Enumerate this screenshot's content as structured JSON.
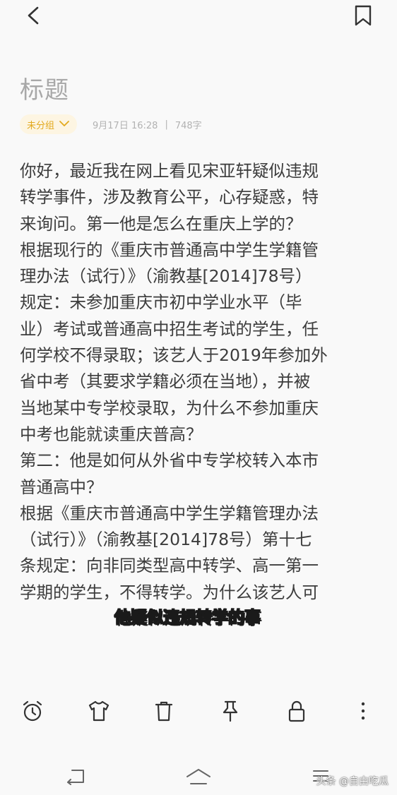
{
  "note": {
    "title": "标题",
    "group": "未分组",
    "date": "9月17日 16:28",
    "separator": "|",
    "word_count": "748字",
    "lines": [
      "你好，最近我在网上看见宋亚轩疑似违规",
      "转学事件，涉及教育公平，心存疑惑，特",
      "来询问。第一他是怎么在重庆上学的？",
      "根据现行的《重庆市普通高中学生学籍管",
      "理办法（试行）》（渝教基[2014]78号）",
      "规定：未参加重庆市初中学业水平（毕",
      "业）考试或普通高中招生考试的学生，任",
      "何学校不得录取；该艺人于2019年参加外",
      "省中考（其要求学籍必须在当地），并被",
      "当地某中专学校录取，为什么不参加重庆",
      "中考也能就读重庆普高？",
      "第二：他是如何从外省中专学校转入本市",
      "普通高中？",
      "根据《重庆市普通高中学生学籍管理办法",
      "（试行）》（渝教基[2014]78号）第十七",
      "条规定：向非同类型高中转学、高一第一",
      "学期的学生，不得转学。为什么该艺人可"
    ]
  },
  "subtitle": "他疑似违规转学的事",
  "watermark": "头条 @自由吃瓜",
  "icons": {
    "back": "back-arrow-icon",
    "bookmark": "bookmark-icon",
    "toolbar": [
      "alarm-clock-icon",
      "tshirt-icon",
      "trash-icon",
      "pin-icon",
      "lock-icon",
      "more-vertical-icon"
    ],
    "nav": [
      "back-nav-icon",
      "home-nav-icon",
      "menu-nav-icon"
    ]
  },
  "colors": {
    "accent": "#e2a91e",
    "chip_bg": "#fdf5e2",
    "title": "#a8a8a8",
    "text": "#3c3c3c",
    "icon": "#333333"
  }
}
